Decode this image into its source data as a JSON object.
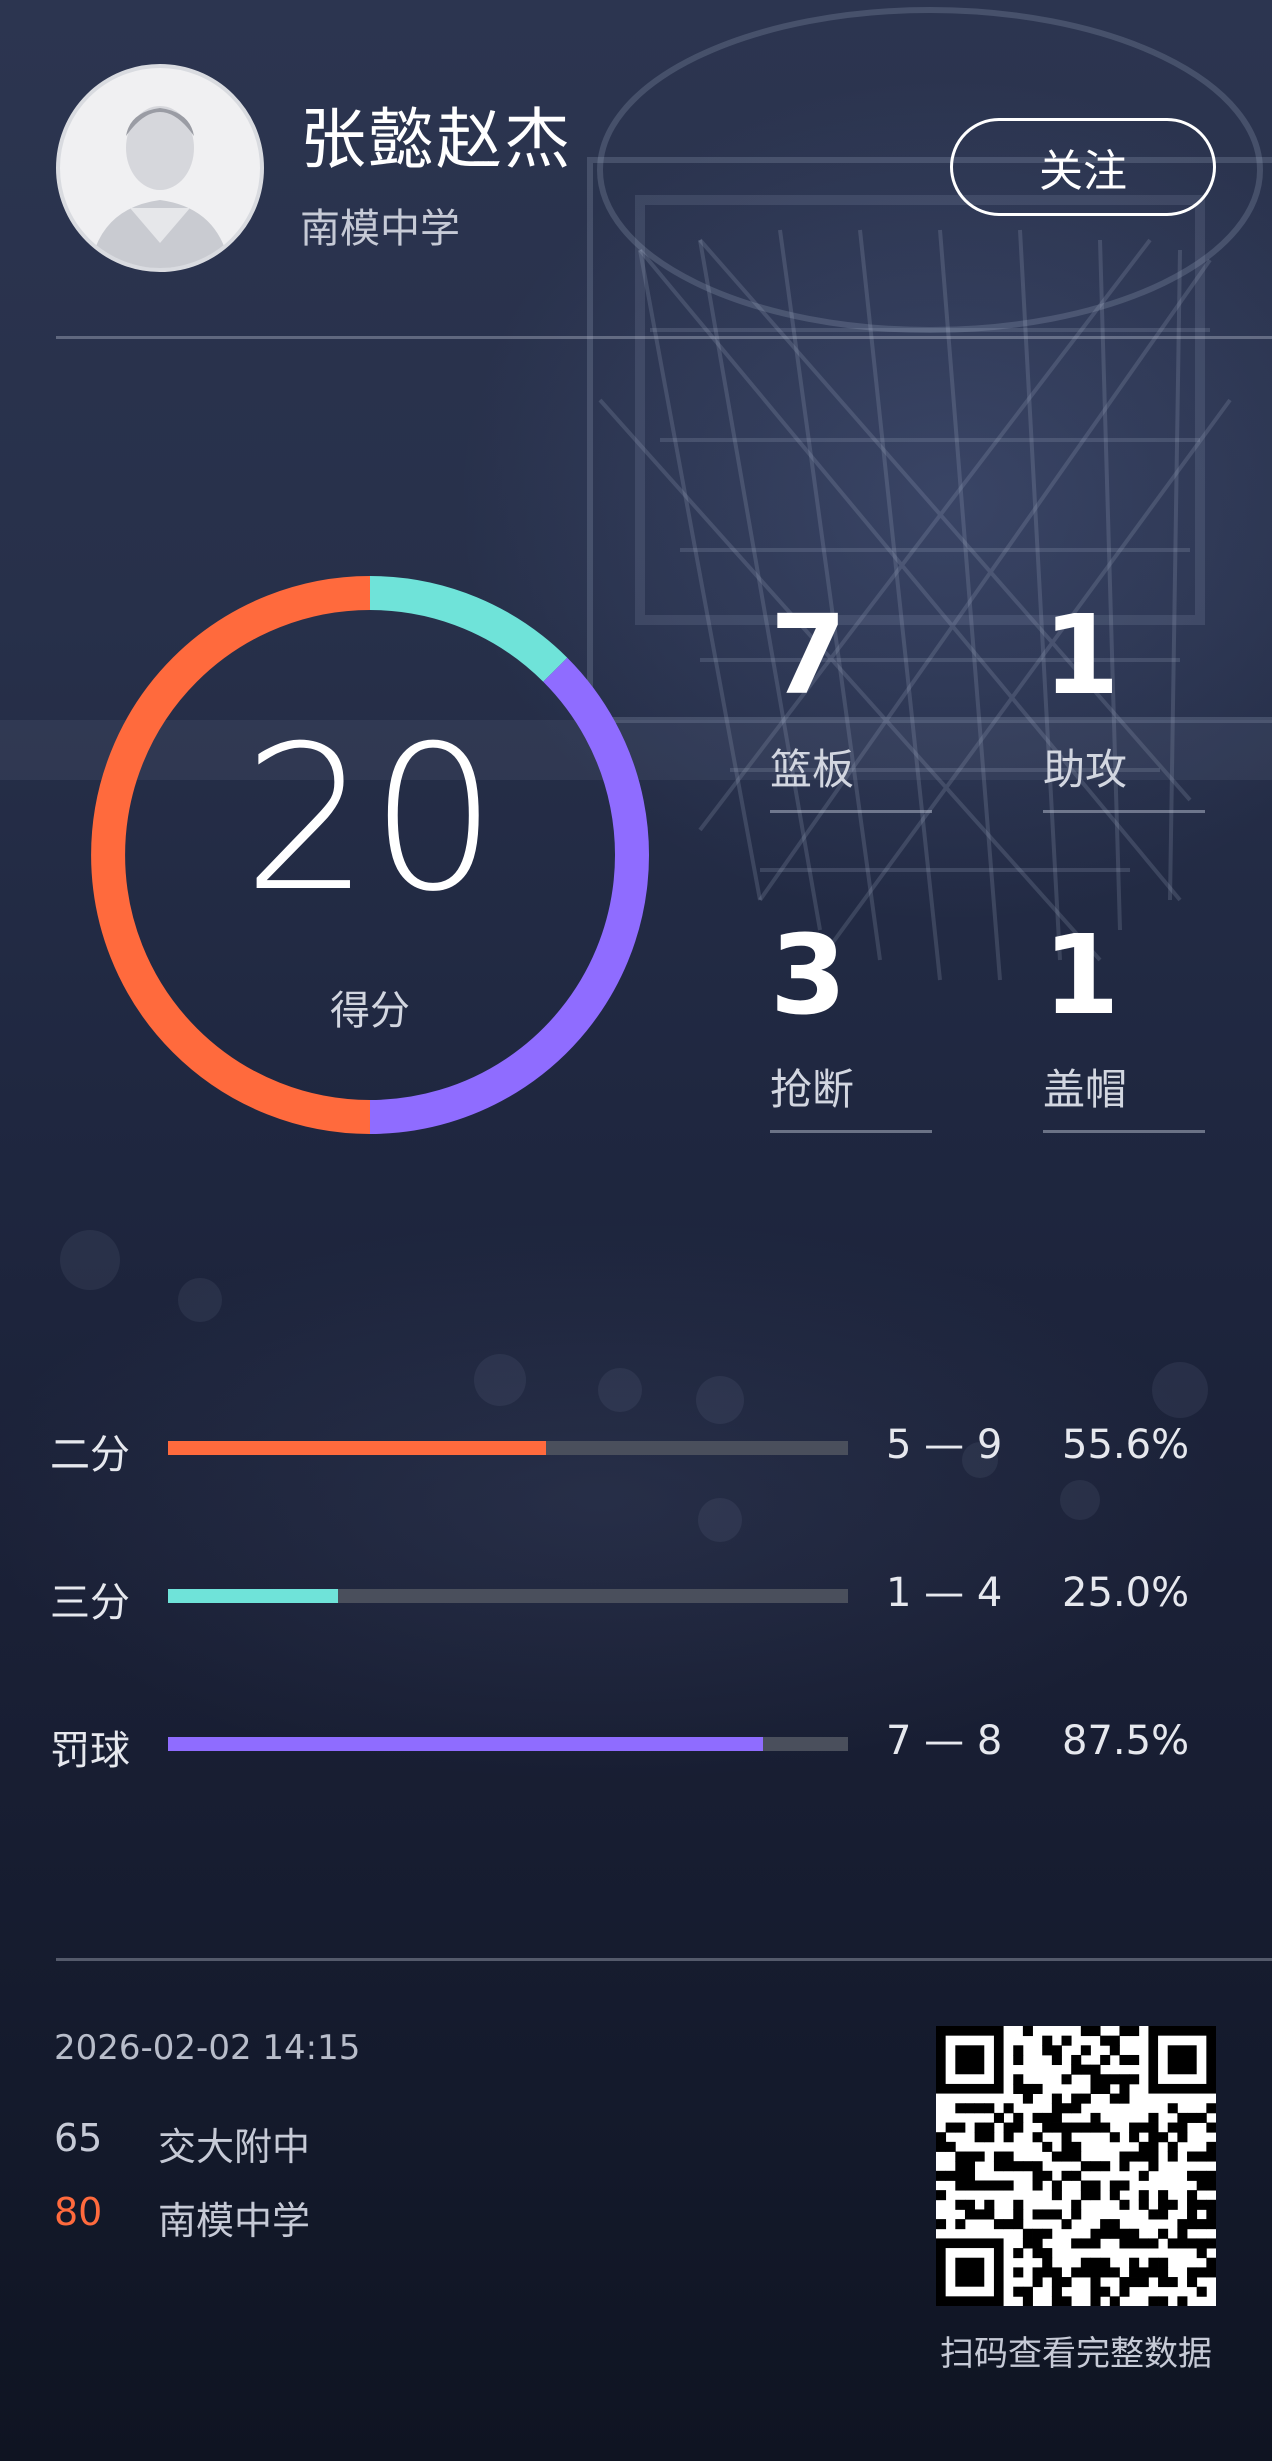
{
  "player": {
    "name": "张懿赵杰",
    "school": "南模中学",
    "follow_label": "关注"
  },
  "points": {
    "value": "20",
    "label": "得分"
  },
  "stats": [
    {
      "value": "7",
      "label": "篮板"
    },
    {
      "value": "1",
      "label": "助攻"
    },
    {
      "value": "3",
      "label": "抢断"
    },
    {
      "value": "1",
      "label": "盖帽"
    }
  ],
  "shooting": [
    {
      "label": "二分",
      "made": "5 — 9",
      "pct": "55.6%",
      "fraction": 0.556,
      "color": "#ff6a3d"
    },
    {
      "label": "三分",
      "made": "1 — 4",
      "pct": "25.0%",
      "fraction": 0.25,
      "color": "#6fe3d9"
    },
    {
      "label": "罚球",
      "made": "7 — 8",
      "pct": "87.5%",
      "fraction": 0.875,
      "color": "#8f6cff"
    }
  ],
  "donut_segments": [
    {
      "fraction": 0.125,
      "color": "#6fe3d9"
    },
    {
      "fraction": 0.375,
      "color": "#8f6cff"
    },
    {
      "fraction": 0.5,
      "color": "#ff6a3d"
    }
  ],
  "game": {
    "datetime": "2026-02-02 14:15",
    "teams": [
      {
        "score": "65",
        "name": "交大附中",
        "score_color": "#c6cad6"
      },
      {
        "score": "80",
        "name": "南模中学",
        "score_color": "#ff6a3d"
      }
    ]
  },
  "qr_caption": "扫码查看完整数据",
  "colors": {
    "accent_orange": "#ff6a3d",
    "accent_teal": "#6fe3d9",
    "accent_purple": "#8f6cff"
  }
}
